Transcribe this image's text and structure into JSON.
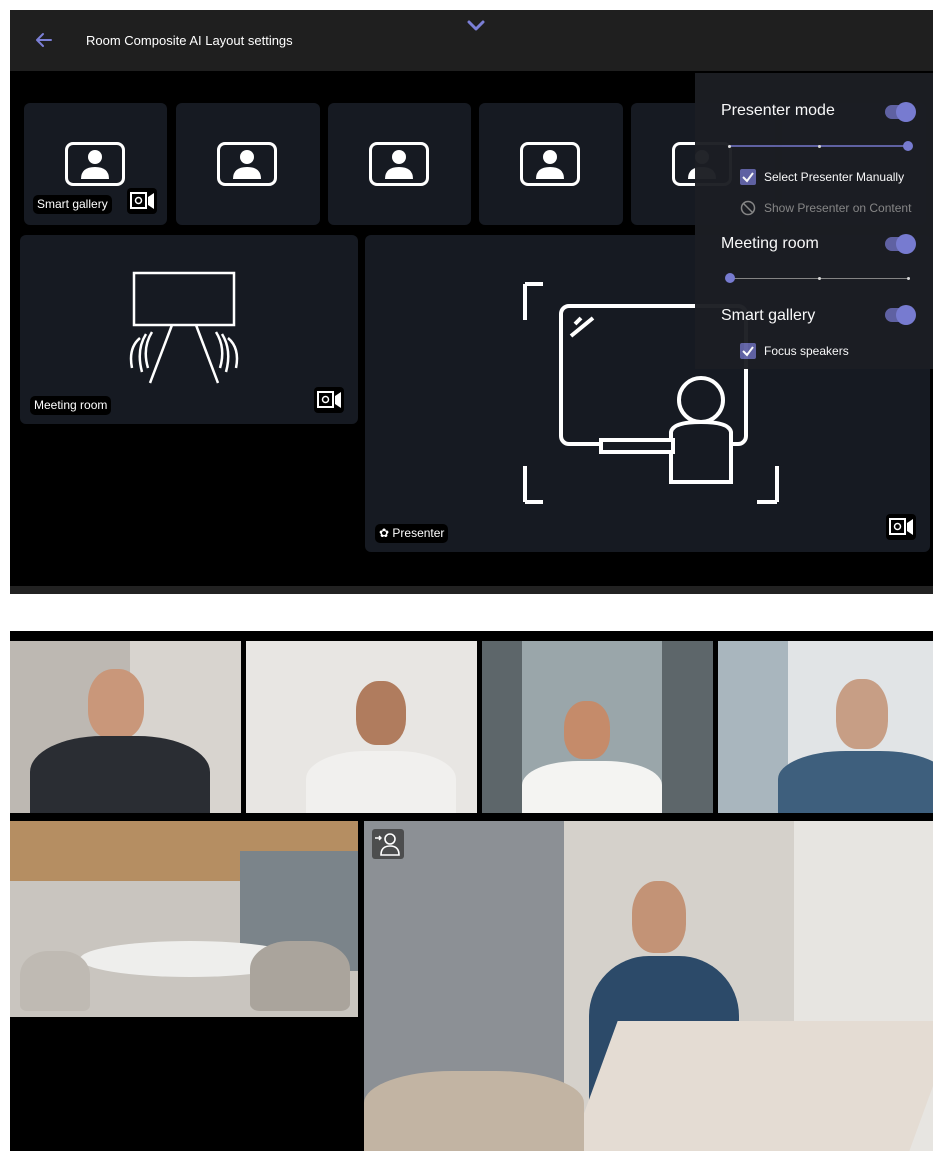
{
  "header": {
    "title": "Room Composite AI Layout settings",
    "back_icon": "back-arrow-icon",
    "collapse_icon": "chevron-down-icon"
  },
  "colors": {
    "accent": "#6264a7",
    "tile_bg": "#161a22",
    "panel_bg": "#000000",
    "header_bg": "#1f1f1f"
  },
  "layout_preview": {
    "smart_gallery_label": "Smart gallery",
    "meeting_room_label": "Meeting room",
    "presenter_label": "Presenter"
  },
  "menu": {
    "presenter_mode": {
      "label": "Presenter mode",
      "enabled": true,
      "slider_level": 1.0
    },
    "select_presenter_manually": {
      "label": "Select Presenter Manually",
      "checked": true
    },
    "show_presenter_on_content": {
      "label": "Show Presenter on Content",
      "enabled": false
    },
    "meeting_room": {
      "label": "Meeting room",
      "enabled": true,
      "slider_level": 0.0
    },
    "smart_gallery": {
      "label": "Smart gallery",
      "enabled": true
    },
    "focus_speakers": {
      "label": "Focus speakers",
      "checked": true
    }
  },
  "video_composite": {
    "presenter_badge_icon": "presenter-person-icon"
  }
}
